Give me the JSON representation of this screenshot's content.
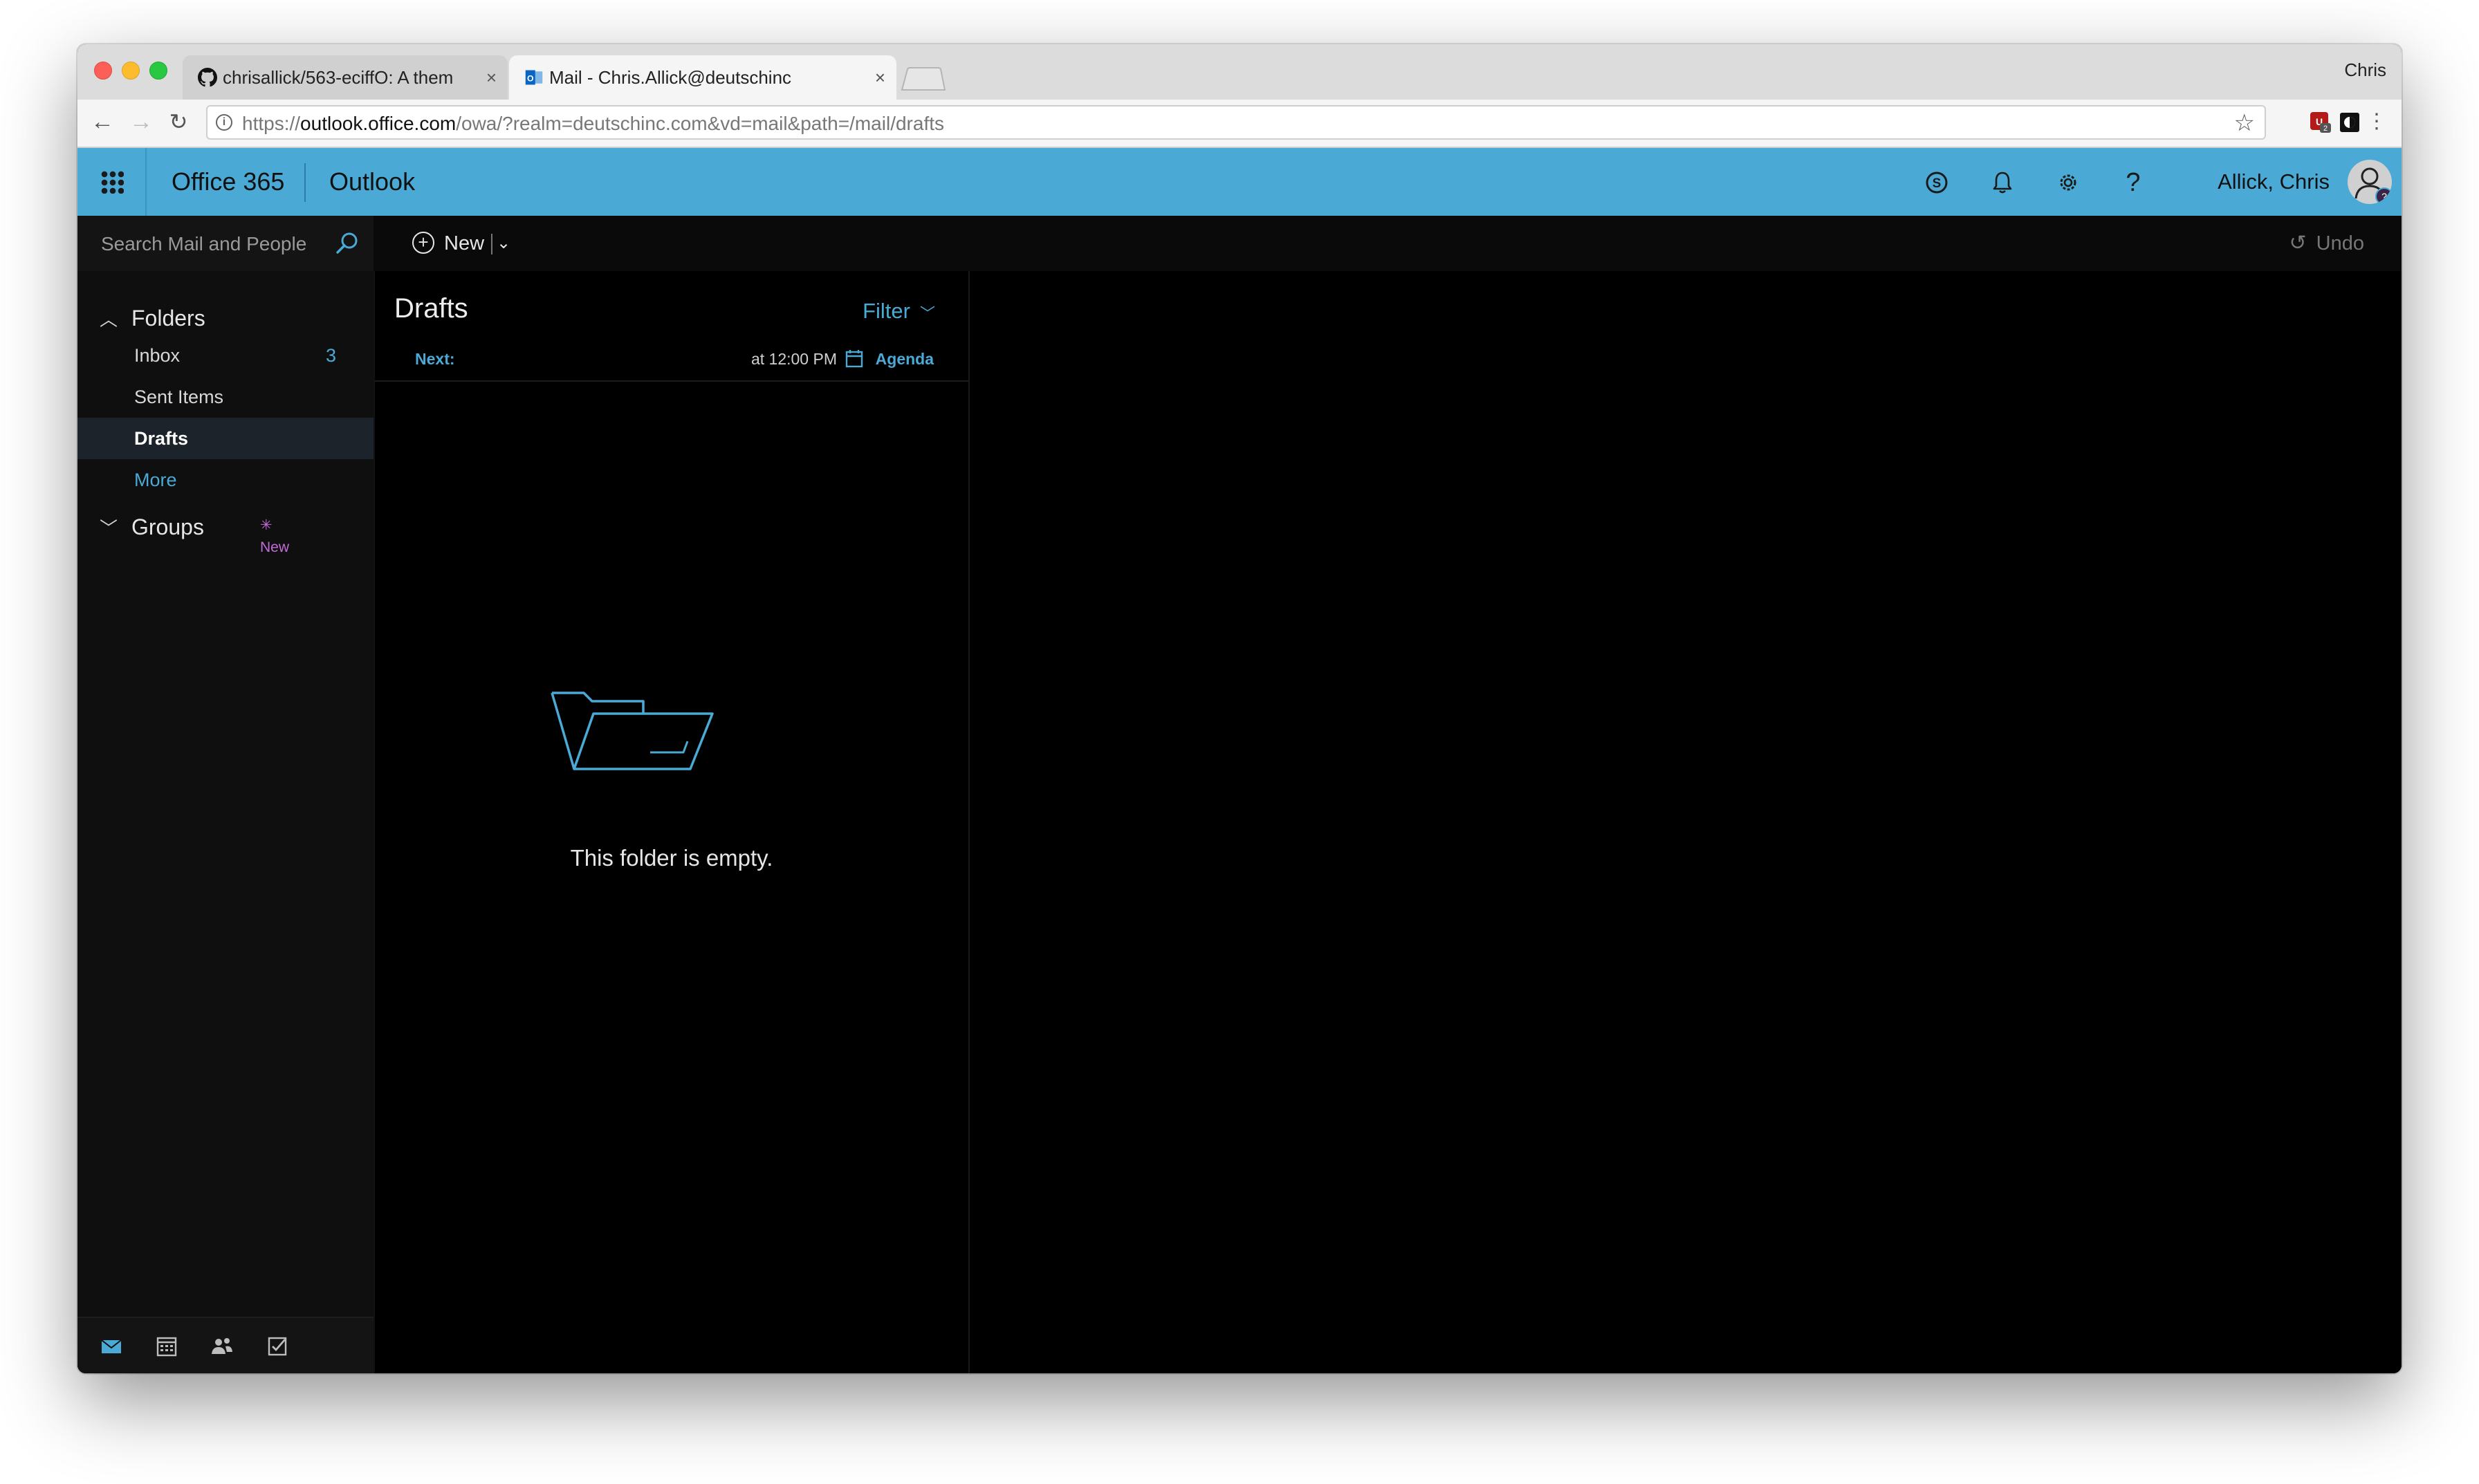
{
  "browser": {
    "profile_name": "Chris",
    "tabs": [
      {
        "title": "chrisallick/563-eciffO: A them",
        "favicon": "github-icon",
        "active": false
      },
      {
        "title": "Mail - Chris.Allick@deutschinc",
        "favicon": "outlook-icon",
        "active": true
      }
    ],
    "url_prefix": "https://",
    "url_host": "outlook.office.com",
    "url_path": "/owa/?realm=deutschinc.com&vd=mail&path=/mail/drafts",
    "extension_badge": "2"
  },
  "header": {
    "brand": "Office 365",
    "app": "Outlook",
    "user_name": "Allick, Chris",
    "avatar_badge": "?",
    "icons": [
      "skype-icon",
      "bell-icon",
      "gear-icon",
      "help-icon"
    ],
    "help_glyph": "?"
  },
  "command_bar": {
    "search_placeholder": "Search Mail and People",
    "new_label": "New",
    "undo_label": "Undo"
  },
  "nav": {
    "folders_label": "Folders",
    "items": [
      {
        "label": "Inbox",
        "count": "3"
      },
      {
        "label": "Sent Items",
        "count": ""
      },
      {
        "label": "Drafts",
        "count": "",
        "selected": true
      },
      {
        "label": "More",
        "count": ""
      }
    ],
    "groups_label": "Groups",
    "groups_badge": "New",
    "bottom_icons": [
      "mail-icon",
      "calendar-icon",
      "people-icon",
      "tasks-icon"
    ]
  },
  "list": {
    "title": "Drafts",
    "filter_label": "Filter",
    "next_label": "Next:",
    "next_time": "at 12:00 PM",
    "agenda_label": "Agenda",
    "empty_message": "This folder is empty."
  },
  "colors": {
    "accent": "#4aaad5",
    "header_bg": "#4aaad5",
    "background": "#000000",
    "nav_bg": "#0f0f0f",
    "groups_new": "#c36bd8"
  }
}
